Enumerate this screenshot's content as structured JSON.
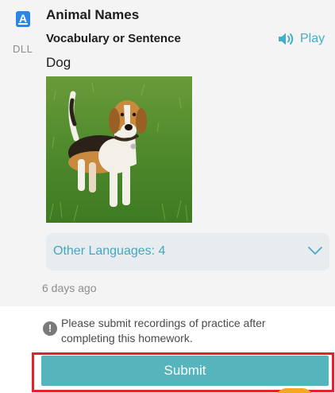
{
  "app": {
    "tag": "DLL",
    "icon": "a-letter-app-icon",
    "icon_letter": "A"
  },
  "card": {
    "title": "Animal Names",
    "subtitle": "Vocabulary or Sentence",
    "play_label": "Play",
    "word": "Dog",
    "image_subject": "dog-photo",
    "other_languages_label": "Other Languages: 4",
    "time_ago": "6 days ago"
  },
  "notice": {
    "icon_text": "!",
    "text": "Please submit recordings of practice after completing this homework."
  },
  "submit": {
    "label": "Submit"
  },
  "colors": {
    "accent": "#3fb0c8",
    "submit_bg": "#56b4bd",
    "highlight_border": "#e0222a",
    "card_bg": "#f4f4f4",
    "app_icon": "#2a86e6"
  }
}
